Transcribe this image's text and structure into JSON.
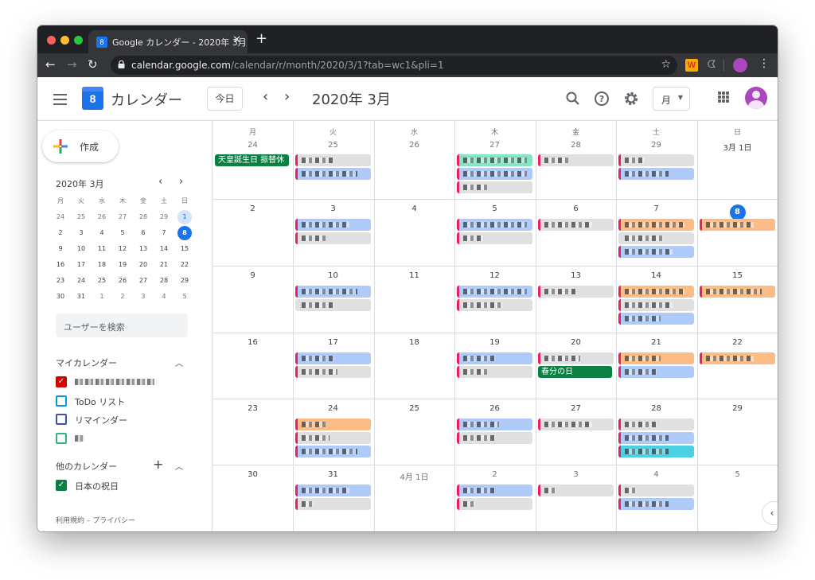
{
  "browser": {
    "tab_title": "Google カレンダー - 2020年 3月",
    "tab_favicon": "8",
    "url_host": "calendar.google.com",
    "url_path": "/calendar/r/month/2020/3/1?tab=wc1&pli=1",
    "colors": {
      "close": "#ff5f57",
      "minimize": "#febc2e",
      "maximize": "#28c840"
    }
  },
  "header": {
    "logo_day": "8",
    "app_name": "カレンダー",
    "today_label": "今日",
    "period": "2020年 3月",
    "view_label": "月"
  },
  "sidebar": {
    "create_label": "作成",
    "mini": {
      "title": "2020年 3月",
      "weekdays": [
        "月",
        "火",
        "水",
        "木",
        "金",
        "土",
        "日"
      ],
      "weeks": [
        [
          "24",
          "25",
          "26",
          "27",
          "28",
          "29",
          "1"
        ],
        [
          "2",
          "3",
          "4",
          "5",
          "6",
          "7",
          "8"
        ],
        [
          "9",
          "10",
          "11",
          "12",
          "13",
          "14",
          "15"
        ],
        [
          "16",
          "17",
          "18",
          "19",
          "20",
          "21",
          "22"
        ],
        [
          "23",
          "24",
          "25",
          "26",
          "27",
          "28",
          "29"
        ],
        [
          "30",
          "31",
          "1",
          "2",
          "3",
          "4",
          "5"
        ]
      ]
    },
    "search_placeholder": "ユーザーを検索",
    "my_calendars_title": "マイカレンダー",
    "my_calendars": [
      {
        "label": "",
        "color": "#d50000",
        "checked": true
      },
      {
        "label": "ToDo リスト",
        "color": "#039be5",
        "checked": false
      },
      {
        "label": "リマインダー",
        "color": "#3f51b5",
        "checked": false
      },
      {
        "label": "",
        "color": "#33b679",
        "checked": false
      }
    ],
    "other_calendars_title": "他のカレンダー",
    "other_calendars": [
      {
        "label": "日本の祝日",
        "color": "#0b8043",
        "checked": true
      }
    ],
    "legal": "利用規約 – プライバシー"
  },
  "month": {
    "weekdays": [
      "月",
      "火",
      "水",
      "木",
      "金",
      "土",
      "日"
    ],
    "weeks": [
      [
        "24",
        "25",
        "26",
        "27",
        "28",
        "29",
        "3月 1日"
      ],
      [
        "2",
        "3",
        "4",
        "5",
        "6",
        "7",
        "8"
      ],
      [
        "9",
        "10",
        "11",
        "12",
        "13",
        "14",
        "15"
      ],
      [
        "16",
        "17",
        "18",
        "19",
        "20",
        "21",
        "22"
      ],
      [
        "23",
        "24",
        "25",
        "26",
        "27",
        "28",
        "29"
      ],
      [
        "30",
        "31",
        "4月 1日",
        "2",
        "3",
        "4",
        "5"
      ]
    ],
    "holidays": {
      "emperor": "天皇誕生日 振替休",
      "equinox": "春分の日"
    },
    "colors": {
      "blue": "#aecbfa",
      "grey": "#e0e0e0",
      "orange": "#fcbc86",
      "mint": "#81e6c1",
      "teal": "#4dd0e1",
      "green": "#0b8043",
      "today": "#1a73e8"
    }
  }
}
